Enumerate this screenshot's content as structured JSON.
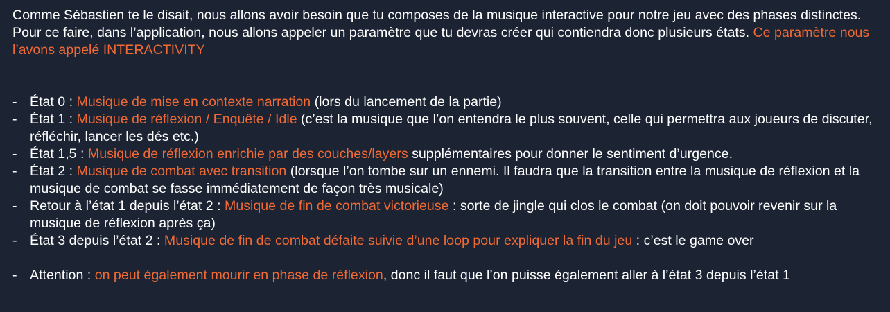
{
  "intro": {
    "text": "Comme Sébastien te le disait, nous allons avoir besoin que tu composes de la musique interactive pour notre jeu avec des phases distinctes. Pour ce faire, dans l’application, nous allons appeler un paramètre que tu devras créer qui contiendra donc plusieurs états. ",
    "highlight": "Ce paramètre nous l’avons appelé INTERACTIVITY"
  },
  "states": [
    {
      "prefix": "État 0 : ",
      "highlight": "Musique de mise en contexte narration",
      "suffix": " (lors du lancement de la partie)"
    },
    {
      "prefix": "État 1 : ",
      "highlight": "Musique de réflexion / Enquête / Idle",
      "suffix": " (c’est la musique que l’on entendra le plus souvent, celle qui permettra aux joueurs de discuter, réfléchir, lancer les dés etc.)"
    },
    {
      "prefix": "État 1,5 : ",
      "highlight": "Musique de réflexion enrichie par des couches/layers",
      "suffix": " supplémentaires pour donner le sentiment d’urgence."
    },
    {
      "prefix": "État 2 : ",
      "highlight": "Musique de combat avec transition",
      "suffix": " (lorsque l’on tombe sur un ennemi. Il faudra que la transition entre la musique de réflexion et la musique de combat se fasse immédiatement de façon très musicale)"
    },
    {
      "prefix": "Retour à l’état 1 depuis l’état 2 : ",
      "highlight": "Musique de fin de combat victorieuse",
      "suffix": " : sorte de jingle qui clos le combat (on doit pouvoir revenir sur la musique de réflexion après ça)"
    },
    {
      "prefix": "État 3 depuis l’état 2 : ",
      "highlight": "Musique de fin de combat défaite suivie d’une loop pour expliquer la fin du jeu",
      "suffix": " : c’est le game over"
    }
  ],
  "attention": {
    "prefix": "Attention : ",
    "highlight": "on peut également mourir en phase de réflexion",
    "suffix": ", donc il faut que l’on puisse également aller à l’état 3 depuis l’état 1"
  },
  "colors": {
    "background": "#1c2333",
    "text": "#ffffff",
    "highlight": "#f06a35"
  }
}
